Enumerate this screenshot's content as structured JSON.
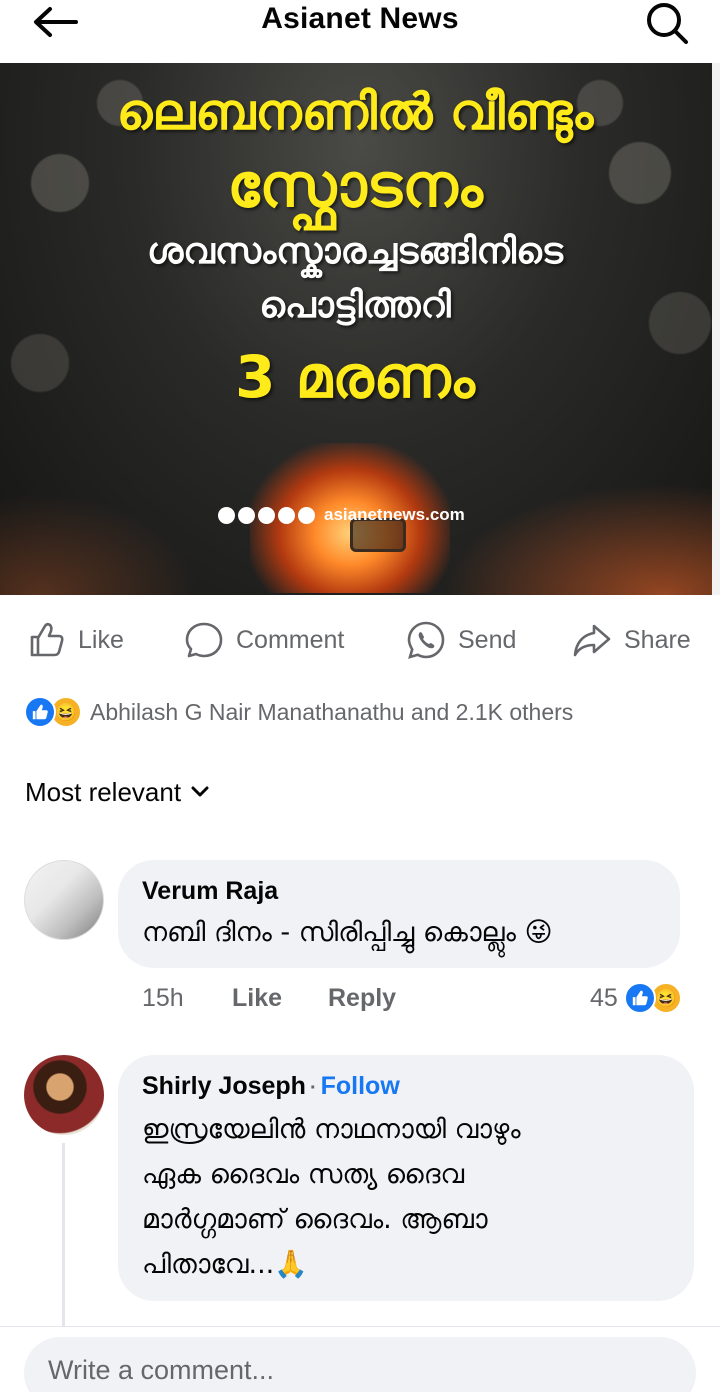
{
  "header": {
    "title": "Asianet News",
    "back_icon": "back-arrow-icon",
    "search_icon": "search-icon"
  },
  "post_image": {
    "line1": "ലെബനണിൽ വീണ്ടും",
    "line2": "സ്ഫോടനം",
    "line3": "ശവസംസ്കാരച്ചടങ്ങിനിടെ",
    "line4": "പൊട്ടിത്തറി",
    "line5": "3 മരണം",
    "watermark": "asianetnews.com"
  },
  "actions": {
    "like": "Like",
    "comment": "Comment",
    "send": "Send",
    "share": "Share"
  },
  "reactions": {
    "summary": "Abhilash G Nair Manathanathu and 2.1K others",
    "like_color": "#1877f2",
    "haha_color": "#f7b125"
  },
  "sort": {
    "label": "Most relevant"
  },
  "comments": [
    {
      "author": "Verum Raja",
      "text": "നബി ദിനം - സിരിപ്പിച്ചു കൊല്ലും 😜",
      "time": "15h",
      "like_label": "Like",
      "reply_label": "Reply",
      "reaction_count": "45"
    },
    {
      "author": "Shirly Joseph",
      "follow": "Follow",
      "text_line1": "ഇസ്രയേലിൻ നാഥനായി വാഴും",
      "text_line2": "ഏക ദൈവം സത്യ ദൈവ",
      "text_line3": "മാർഗ്ഗമാണ് ദൈവം. ആബാ",
      "text_line4": "പിതാവേ...🙏"
    }
  ],
  "composer": {
    "placeholder": "Write a comment..."
  },
  "colors": {
    "accent": "#1877f2",
    "headline_yellow": "#ffea1a",
    "muted": "#65676b",
    "bubble": "#f0f2f5"
  }
}
